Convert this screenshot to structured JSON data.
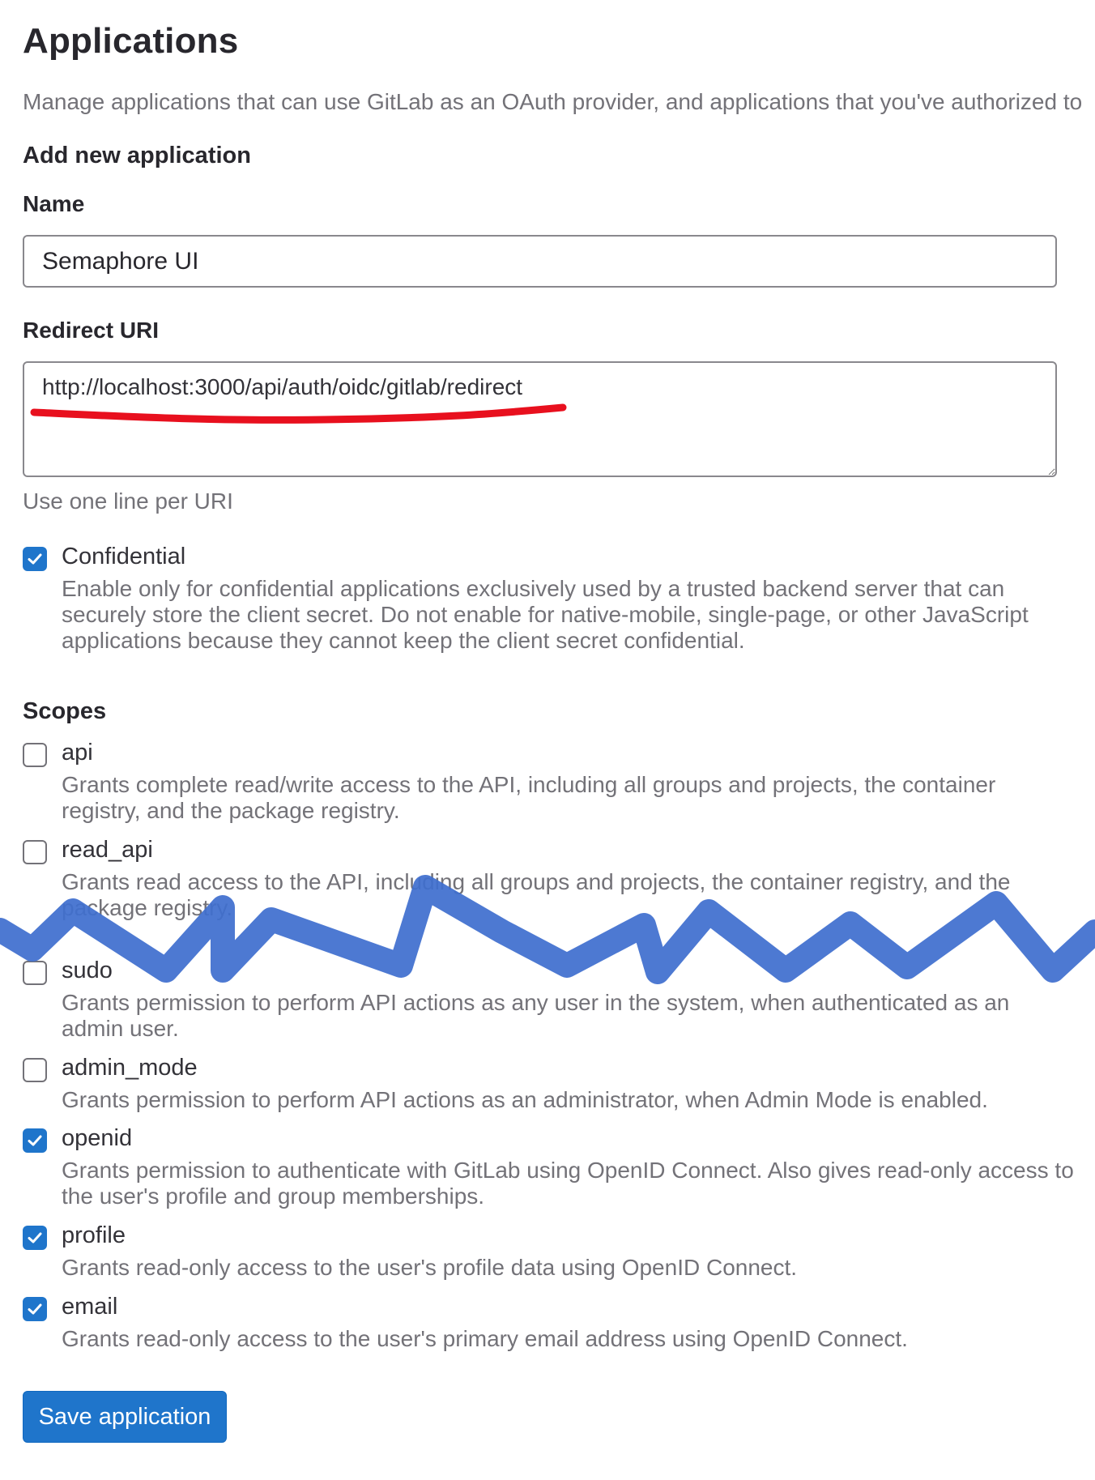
{
  "page": {
    "title": "Applications",
    "lead": "Manage applications that can use GitLab as an OAuth provider, and applications that you've authorized to"
  },
  "form": {
    "heading": "Add new application",
    "name_label": "Name",
    "name_value": "Semaphore UI",
    "redirect_label": "Redirect URI",
    "redirect_value": "http://localhost:3000/api/auth/oidc/gitlab/redirect",
    "redirect_help": "Use one line per URI",
    "confidential": {
      "label": "Confidential",
      "checked": true,
      "description": "Enable only for confidential applications exclusively used by a trusted backend server that can securely store the client secret. Do not enable for native-mobile, single-page, or other JavaScript applications because they cannot keep the client secret confidential."
    },
    "scopes_heading": "Scopes",
    "scopes": [
      {
        "label": "api",
        "checked": false,
        "description": "Grants complete read/write access to the API, including all groups and projects, the container registry, and the package registry."
      },
      {
        "label": "read_api",
        "checked": false,
        "description": "Grants read access to the API, including all groups and projects, the container registry, and the package registry."
      },
      {
        "label": "sudo",
        "checked": false,
        "description": "Grants permission to perform API actions as any user in the system, when authenticated as an admin user."
      },
      {
        "label": "admin_mode",
        "checked": false,
        "description": "Grants permission to perform API actions as an administrator, when Admin Mode is enabled."
      },
      {
        "label": "openid",
        "checked": true,
        "description": "Grants permission to authenticate with GitLab using OpenID Connect. Also gives read-only access to the user's profile and group memberships."
      },
      {
        "label": "profile",
        "checked": true,
        "description": "Grants read-only access to the user's profile data using OpenID Connect."
      },
      {
        "label": "email",
        "checked": true,
        "description": "Grants read-only access to the user's primary email address using OpenID Connect."
      }
    ],
    "save_label": "Save application"
  },
  "colors": {
    "accent": "#1f75cb",
    "underline_annotation": "#e8101e",
    "scribble_annotation": "#3f6fcf"
  }
}
